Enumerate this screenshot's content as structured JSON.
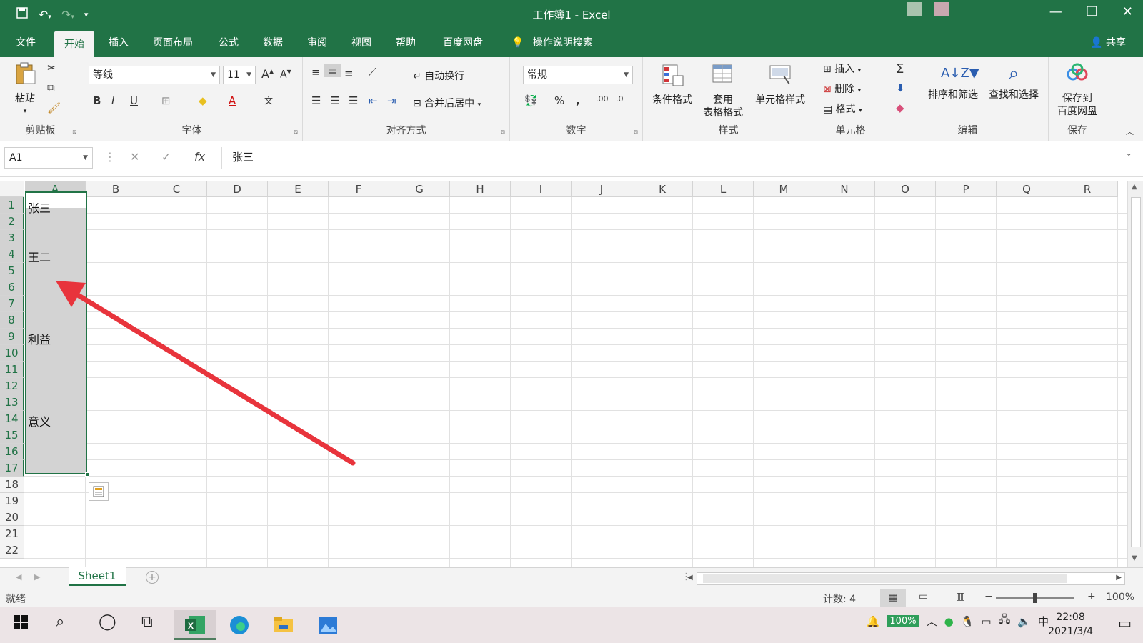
{
  "window": {
    "title": "工作簿1  -  Excel",
    "controls": {
      "minimize": "minimize-icon",
      "restore": "restore-icon",
      "close": "close-icon"
    }
  },
  "quick_access": [
    "save-icon",
    "undo-icon",
    "redo-icon",
    "customize-icon"
  ],
  "tabs": [
    "文件",
    "开始",
    "插入",
    "页面布局",
    "公式",
    "数据",
    "审阅",
    "视图",
    "帮助",
    "百度网盘"
  ],
  "active_tab": "开始",
  "tell_me": "操作说明搜索",
  "share": "共享",
  "ribbon": {
    "clipboard": {
      "label": "剪贴板",
      "paste": "粘贴"
    },
    "font": {
      "label": "字体",
      "font_name": "等线",
      "font_size": "11"
    },
    "alignment": {
      "label": "对齐方式",
      "wrap_text": "自动换行",
      "merge_center": "合并后居中"
    },
    "number": {
      "label": "数字",
      "format": "常规"
    },
    "styles": {
      "label": "样式",
      "conditional": "条件格式",
      "table_line1": "套用",
      "table_line2": "表格格式",
      "cell_styles": "单元格样式"
    },
    "cells": {
      "label": "单元格",
      "insert": "插入",
      "delete": "删除",
      "format": "格式"
    },
    "editing": {
      "label": "编辑",
      "sort_filter": "排序和筛选",
      "find_select": "查找和选择"
    },
    "save": {
      "label": "保存",
      "line1": "保存到",
      "line2": "百度网盘"
    }
  },
  "formula_bar": {
    "name_box": "A1",
    "formula": "张三",
    "fx": "fx"
  },
  "grid": {
    "columns": [
      "A",
      "B",
      "C",
      "D",
      "E",
      "F",
      "G",
      "H",
      "I",
      "J",
      "K",
      "L",
      "M",
      "N",
      "O",
      "P",
      "Q",
      "R"
    ],
    "rows": [
      "1",
      "2",
      "3",
      "4",
      "5",
      "6",
      "7",
      "8",
      "9",
      "10",
      "11",
      "12",
      "13",
      "14",
      "15",
      "16",
      "17",
      "18",
      "19",
      "20",
      "21",
      "22"
    ],
    "cells": [
      {
        "ref": "A1",
        "row": 1,
        "text": "张三"
      },
      {
        "ref": "A4",
        "row": 4,
        "text": "王二"
      },
      {
        "ref": "A9",
        "row": 9,
        "text": "利益"
      },
      {
        "ref": "A14",
        "row": 14,
        "text": "意义"
      }
    ],
    "selection": "A1:A17"
  },
  "sheets": [
    "Sheet1"
  ],
  "status": {
    "ready": "就绪",
    "count": "计数: 4",
    "zoom": "100%"
  },
  "taskbar": {
    "battery": "100%",
    "ime": "中",
    "time": "22:08",
    "date": "2021/3/4"
  },
  "colors": {
    "excel_green": "#217346",
    "annotation_arrow": "#e8343c"
  }
}
